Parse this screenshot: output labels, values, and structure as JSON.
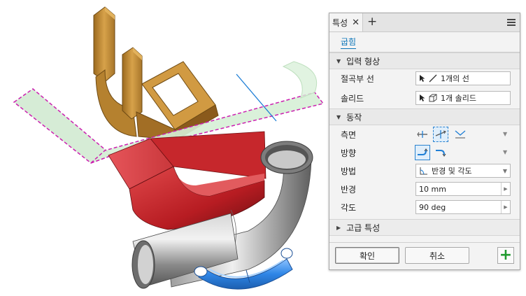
{
  "panel": {
    "tab_label": "특성",
    "feature_name": "굽힘",
    "sections": {
      "input_geometry": "입력 형상",
      "behavior": "동작",
      "advanced": "고급 특성"
    },
    "bend_line": {
      "label": "절곡부 선",
      "value": "1개의 선"
    },
    "solid": {
      "label": "솔리드",
      "value": "1개 솔리드"
    },
    "side": {
      "label": "측면"
    },
    "direction": {
      "label": "방향"
    },
    "method": {
      "label": "방법",
      "value": "반경 및 각도"
    },
    "radius": {
      "label": "반경",
      "value": "10 mm"
    },
    "angle": {
      "label": "각도",
      "value": "90 deg"
    },
    "ok_label": "확인",
    "cancel_label": "취소"
  },
  "colors": {
    "accent": "#0a74b8",
    "selected_border": "#2a82cf",
    "add_green": "#1f9a2e",
    "preview_magenta": "#cc1fb0",
    "brass": "#c8923a",
    "red_part": "#c4262b",
    "steel": "#8c8c8c",
    "blue_part": "#2f86e6",
    "preview_green": "#cfe9cf"
  }
}
